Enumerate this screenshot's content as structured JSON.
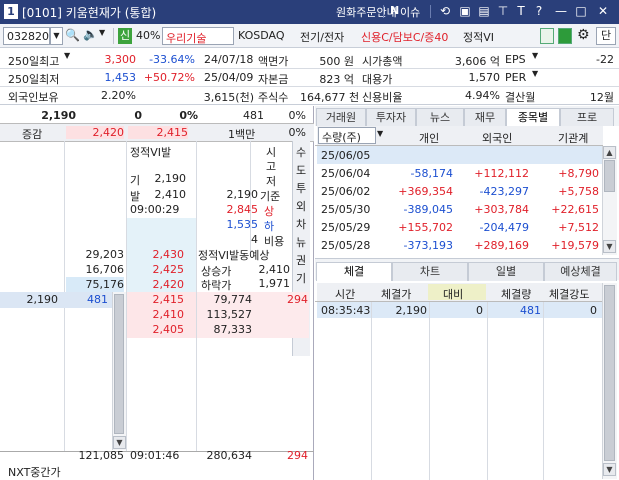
{
  "title": {
    "num": "1",
    "text": "[0101] 키움현재가 (통합)",
    "menu1": "원화주문안내",
    "menu2": "N",
    "menu3": "이슈"
  },
  "toolbar": {
    "code": "032820",
    "mode": "신",
    "pct": "40%",
    "name": "우리기술",
    "market": "KOSDAQ",
    "sector": "전기/전자",
    "tags": "신용C/담보C/증40",
    "status": "정적VI",
    "btn_label": "단"
  },
  "info": {
    "r1": {
      "l": "250일최고",
      "v": "3,300",
      "p": "-33.64%",
      "d": "24/07/18",
      "k1": "액면가",
      "v1": "500 원",
      "k2": "시가총액",
      "v2": "3,606 억",
      "k3": "EPS",
      "v3": "-22"
    },
    "r2": {
      "l": "250일최저",
      "v": "1,453",
      "p": "+50.72%",
      "d": "25/04/09",
      "k1": "자본금",
      "v1": "823 억",
      "k2": "대용가",
      "v2": "1,570",
      "k3": "PER",
      "v3": ""
    },
    "r3": {
      "l": "외국인보유",
      "v": "2.20%",
      "d": "3,615(천)",
      "k1": "주식수",
      "v1": "164,677 천",
      "k2": "신용비율",
      "v2": "4.94%",
      "k3": "결산월",
      "v3": "12월"
    }
  },
  "quote": {
    "price": "2,190",
    "chg": "0",
    "pct": "0%",
    "vol": "481",
    "volpct": "0%",
    "diff_label": "증감",
    "diff1": "2,420",
    "diff2": "2,415",
    "unit": "1백만",
    "unitpct": "0%",
    "vi_title": "정적VI발",
    "vi_k1": "기",
    "vi_v1": "2,190",
    "vi_k2": "발",
    "vi_v2": "2,410",
    "vi_time": "09:00:29",
    "side_chars": [
      "시",
      "고",
      "저",
      "기준",
      "상",
      "하",
      "비용"
    ],
    "mid_vals": [
      "2,190",
      "2,845",
      "1,535",
      "4"
    ],
    "vi_forecast": "정적VI발동예상",
    "up_label": "상승가",
    "up_val": "2,410",
    "dn_label": "하락가",
    "dn_val": "1,971",
    "nxt_label": "NXT중간가",
    "tot_ask": "121,085",
    "time2": "09:01:46",
    "tot_bid": "280,634",
    "bot_num": "294"
  },
  "asks": [
    {
      "q": "29,203",
      "p": "2,430"
    },
    {
      "q": "16,706",
      "p": "2,425"
    },
    {
      "q": "75,176",
      "p": "2,420"
    }
  ],
  "bids": [
    {
      "p": "2,415",
      "q": "79,774"
    },
    {
      "p": "2,410",
      "q": "113,527"
    },
    {
      "p": "2,405",
      "q": "87,333"
    }
  ],
  "trade_row": {
    "price": "2,190",
    "qty": "481",
    "num": "294"
  },
  "side_tabs": [
    "수",
    "도",
    "투",
    "외",
    "차",
    "뉴",
    "권",
    "기"
  ],
  "rtabs": [
    "거래원",
    "투자자",
    "뉴스",
    "재무",
    "종목별",
    "프로"
  ],
  "inv": {
    "headers": [
      "수량(주)",
      "개인",
      "외국인",
      "기관계"
    ],
    "rows": [
      [
        "25/06/05",
        "",
        "",
        ""
      ],
      [
        "25/06/04",
        "-58,174",
        "+112,112",
        "+8,790"
      ],
      [
        "25/06/02",
        "+369,354",
        "-423,297",
        "+5,758"
      ],
      [
        "25/05/30",
        "-389,045",
        "+303,784",
        "+22,615"
      ],
      [
        "25/05/29",
        "+155,702",
        "-204,479",
        "+7,512"
      ],
      [
        "25/05/28",
        "-373,193",
        "+289,169",
        "+19,579"
      ]
    ]
  },
  "ctabs": [
    "체결",
    "차트",
    "일별",
    "예상체결"
  ],
  "exec": {
    "headers": [
      "시간",
      "체결가",
      "대비",
      "체결량",
      "체결강도"
    ],
    "row": [
      "08:35:43",
      "2,190",
      "0",
      "481",
      "0"
    ]
  }
}
